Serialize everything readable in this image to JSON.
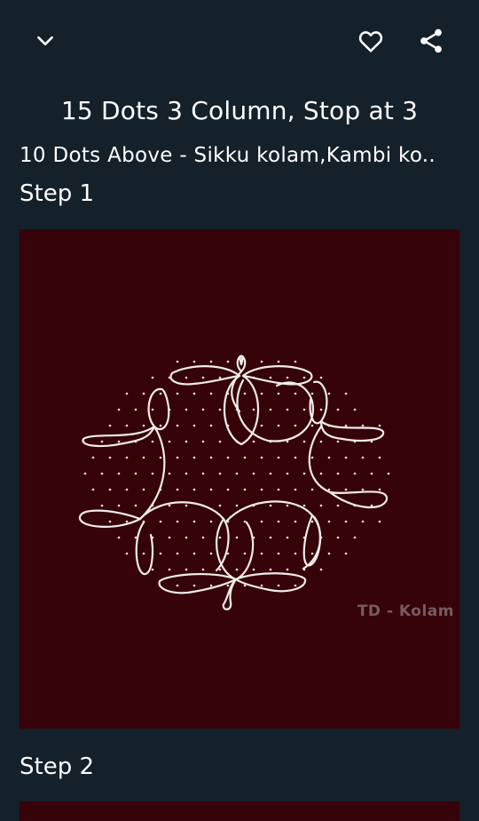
{
  "header": {
    "back_icon": "chevron-down-icon",
    "favorite_icon": "heart-outline-icon",
    "share_icon": "share-icon"
  },
  "title": "15 Dots 3 Column, Stop at 3",
  "subtitle": "10 Dots Above - Sikku kolam,Kambi ko..",
  "steps": [
    {
      "label": "Step 1",
      "watermark": "TD - Kolam"
    },
    {
      "label": "Step 2"
    }
  ],
  "colors": {
    "background": "#14202a",
    "image_background": "#360309",
    "line": "#f3ecea"
  }
}
